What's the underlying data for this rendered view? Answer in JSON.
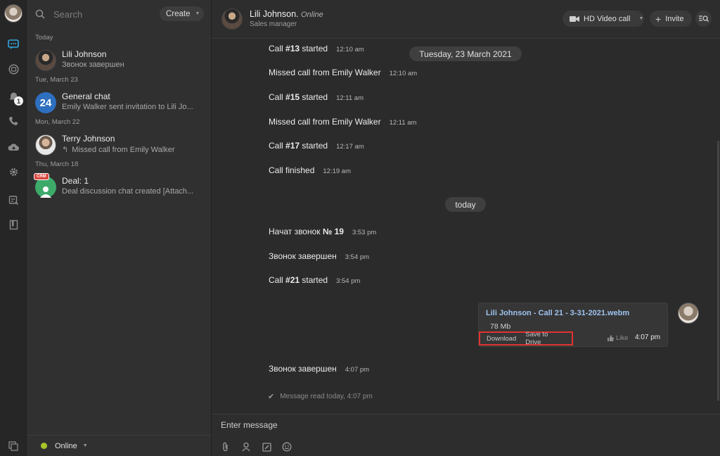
{
  "sidebar_rail": {
    "icons": [
      "avatar",
      "chat-icon",
      "channels-icon",
      "notifications-icon",
      "phone-icon",
      "cloud-icon",
      "settings-icon",
      "tasks-icon",
      "knowledge-icon",
      "window-icon"
    ],
    "notification_count": "1"
  },
  "chat_list": {
    "search_placeholder": "Search",
    "create_label": "Create",
    "groups": {
      "today": "Today",
      "tue": "Tue, March 23",
      "mon": "Mon, March 22",
      "thu": "Thu, March 18"
    },
    "items": [
      {
        "name": "Lili Johnson",
        "preview": "Звонок завершен"
      },
      {
        "name": "General chat",
        "preview": "Emily Walker sent invitation to Lili Jo...",
        "avatar_text": "24"
      },
      {
        "name": "Terry Johnson",
        "preview": "Missed call from Emily Walker"
      },
      {
        "name": "Deal: 1",
        "preview": "Deal discussion chat created [Attach...",
        "badge": "CRM"
      }
    ],
    "status": "Online",
    "status_color": "#a7c52a"
  },
  "header": {
    "name": "Lili Johnson.",
    "presence": "Online",
    "role": "Sales manager",
    "video_label": "HD Video call",
    "invite_label": "Invite"
  },
  "messages": [
    {
      "pre": "Call ",
      "bold": "#13",
      "post": " started",
      "time": "12:10 am"
    },
    {
      "pre": "Missed call from Emily Walker",
      "bold": "",
      "post": "",
      "time": "12:10 am"
    },
    {
      "pre": "Call ",
      "bold": "#15",
      "post": " started",
      "time": "12:11 am"
    },
    {
      "pre": "Missed call from Emily Walker",
      "bold": "",
      "post": "",
      "time": "12:11 am"
    },
    {
      "pre": "Call ",
      "bold": "#17",
      "post": " started",
      "time": "12:17 am"
    },
    {
      "pre": "Call finished",
      "bold": "",
      "post": "",
      "time": "12:19 am"
    },
    {
      "pre": "Начат звонок ",
      "bold": "№ 19",
      "post": "",
      "time": "3:53 pm"
    },
    {
      "pre": "Звонок завершен",
      "bold": "",
      "post": "",
      "time": "3:54 pm"
    },
    {
      "pre": "Call ",
      "bold": "#21",
      "post": " started",
      "time": "3:54 pm"
    },
    {
      "pre": "Звонок завершен",
      "bold": "",
      "post": "",
      "time": "4:07 pm"
    }
  ],
  "date_pills": {
    "first": "Tuesday, 23 March 2021",
    "second": "today"
  },
  "file_message": {
    "filename": "Lili Johnson - Call 21 - 3-31-2021.webm",
    "size": "78 Mb",
    "download_label": "Download",
    "save_label": "Save to Drive",
    "like_label": "Like",
    "time": "4:07 pm",
    "highlight_color": "#e0332f"
  },
  "read_receipt": "Message read today, 4:07 pm",
  "composer": {
    "placeholder": "Enter message",
    "tools": [
      "attach-icon",
      "contact-icon",
      "edit-icon",
      "emoji-icon"
    ]
  }
}
